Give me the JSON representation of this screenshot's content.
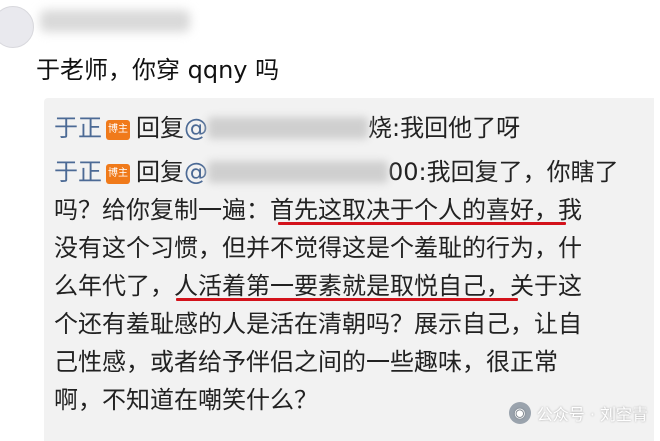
{
  "comment": {
    "text": "于老师，你穿 qqny 吗"
  },
  "replies": [
    {
      "user": "于正",
      "badge": "博主",
      "reply_word": "回复",
      "mention_prefix": "@",
      "mention_suffix": "烧",
      "message": ":我回他了呀"
    },
    {
      "user": "于正",
      "badge": "博主",
      "reply_word": "回复",
      "mention_prefix": "@",
      "mention_suffix": "00",
      "message": ":我回复了，你瞎了"
    }
  ],
  "body_lines": [
    "吗？给你复制一遍：首先这取决于个人的喜好，我",
    "没有这个习惯，但并不觉得这是个羞耻的行为，什",
    "么年代了，人活着第一要素就是取悦自己，关于这",
    "个还有羞耻感的人是活在清朝吗？展示自己，让自",
    "己性感，或者给予伴侣之间的一些趣味，很正常",
    "啊，不知道在嘲笑什么？"
  ],
  "watermark": {
    "text": "公众号 · 刘空青"
  },
  "colors": {
    "username": "#4c6a95",
    "badge": "#f07a1a",
    "underline": "#d3121b",
    "reply_bg": "#f2f2f2"
  }
}
